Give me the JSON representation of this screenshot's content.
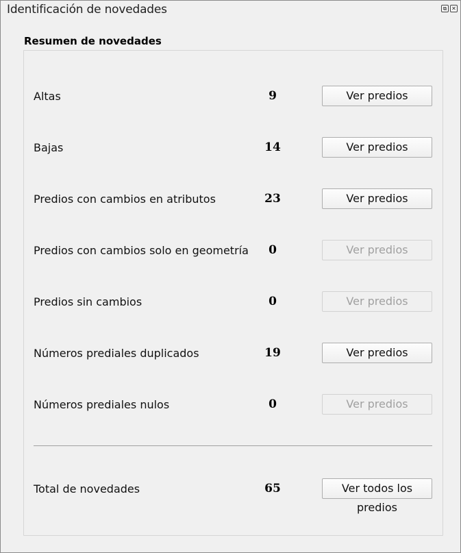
{
  "window": {
    "title": "Identificación de novedades",
    "restore_glyph": "⧉",
    "close_glyph": "✕"
  },
  "summary": {
    "heading": "Resumen de novedades",
    "rows": [
      {
        "label": "Altas",
        "count": "9",
        "button": "Ver predios",
        "enabled": true
      },
      {
        "label": "Bajas",
        "count": "14",
        "button": "Ver predios",
        "enabled": true
      },
      {
        "label": "Predios con cambios en atributos",
        "count": "23",
        "button": "Ver predios",
        "enabled": true
      },
      {
        "label": "Predios con cambios solo en geometría",
        "count": "0",
        "button": "Ver predios",
        "enabled": false
      },
      {
        "label": "Predios sin cambios",
        "count": "0",
        "button": "Ver predios",
        "enabled": false
      },
      {
        "label": "Números prediales duplicados",
        "count": "19",
        "button": "Ver predios",
        "enabled": true
      },
      {
        "label": "Números prediales nulos",
        "count": "0",
        "button": "Ver predios",
        "enabled": false
      }
    ],
    "total": {
      "label": "Total de novedades",
      "count": "65",
      "button": "Ver todos los predios"
    }
  }
}
